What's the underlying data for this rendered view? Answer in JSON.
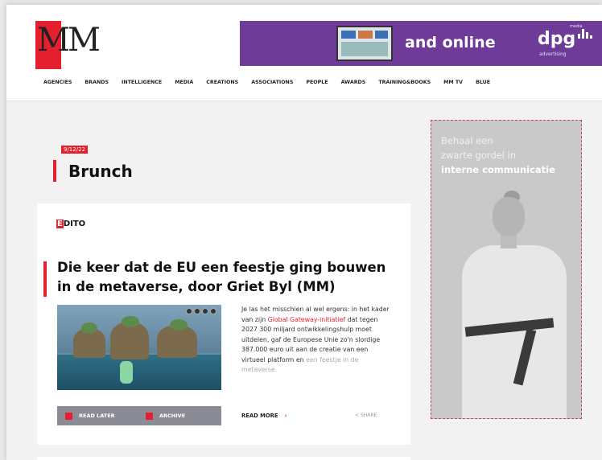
{
  "logo": {
    "text": "MM"
  },
  "banner": {
    "online_text": "and online",
    "dpg_text": "dpg",
    "dpg_media": "media",
    "dpg_sub": "advertising"
  },
  "nav": {
    "items": [
      "AGENCIES",
      "BRANDS",
      "INTELLIGENCE",
      "MEDIA",
      "CREATIONS",
      "ASSOCIATIONS",
      "PEOPLE",
      "AWARDS",
      "TRAINING&BOOKS",
      "MM TV",
      "BLUE"
    ]
  },
  "section": {
    "date": "9/12/22",
    "title": "Brunch"
  },
  "article": {
    "category_initial": "E",
    "category_rest": "DITO",
    "title": "Die keer dat de EU een feestje ging bouwen in de metaverse, door Griet Byl (MM)",
    "excerpt_before": "Je las het misschien al wel ergens: in het kader van zijn ",
    "excerpt_link": "Global Gateway-initiatief",
    "excerpt_after": " dat tegen 2027 300 miljard ontwikkelingshulp moet uitdelen, gaf de Europese Unie zo'n slordige 387.000 euro uit aan de creatie van een virtueel platform en",
    "excerpt_faded": "een feestje in de metaverse.",
    "read_later": "READ LATER",
    "archive": "ARCHIVE",
    "read_more": "READ MORE",
    "read_more_chevron": "›",
    "share": "SHARE"
  },
  "ad": {
    "line1": "Behaal een",
    "line2": "zwarte gordel in",
    "line3": "interne communicatie"
  },
  "colors": {
    "accent": "#e5202e",
    "banner": "#6f3b98",
    "actions_bar": "#8b8b96"
  }
}
